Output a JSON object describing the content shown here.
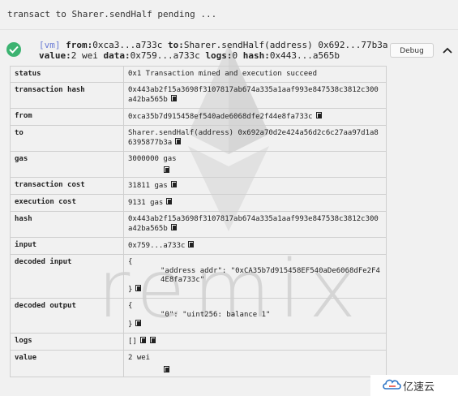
{
  "pending": "transact to Sharer.sendHalf pending ...",
  "header": {
    "vm": "[vm]",
    "from_label": "from:",
    "from_value": "0xca3...a733c",
    "to_label": "to:",
    "to_value": "Sharer.sendHalf(address) 0x692...77b3a",
    "value_label": "value:",
    "value_value": "2 wei",
    "data_label": "data:",
    "data_value": "0x759...a733c",
    "logs_label": "logs:",
    "logs_value": "0",
    "hash_label": "hash:",
    "hash_value": "0x443...a565b"
  },
  "debug_label": "Debug",
  "rows": {
    "status": {
      "key": "status",
      "value": "0x1 Transaction mined and execution succeed"
    },
    "transaction_hash": {
      "key": "transaction hash",
      "value": "0x443ab2f15a3698f3107817ab674a335a1aaf993e847538c3812c300a42ba565b"
    },
    "from": {
      "key": "from",
      "value": "0xca35b7d915458ef540ade6068dfe2f44e8fa733c"
    },
    "to": {
      "key": "to",
      "value": "Sharer.sendHalf(address) 0x692a70d2e424a56d2c6c27aa97d1a86395877b3a"
    },
    "gas": {
      "key": "gas",
      "value": "3000000 gas"
    },
    "transaction_cost": {
      "key": "transaction cost",
      "value": "31811 gas"
    },
    "execution_cost": {
      "key": "execution cost",
      "value": "9131 gas"
    },
    "hash": {
      "key": "hash",
      "value": "0x443ab2f15a3698f3107817ab674a335a1aaf993e847538c3812c300a42ba565b"
    },
    "input": {
      "key": "input",
      "value": "0x759...a733c"
    },
    "decoded_input": {
      "key": "decoded input",
      "open": "{",
      "line": "\"address addr\": \"0xCA35b7d915458EF540aDe6068dFe2F44E8fa733c\"",
      "close": "}"
    },
    "decoded_output": {
      "key": "decoded output",
      "open": "{",
      "line": "\"0\": \"uint256: balance 1\"",
      "close": "}"
    },
    "logs": {
      "key": "logs",
      "value": "[]"
    },
    "value": {
      "key": "value",
      "value": "2 wei"
    }
  },
  "watermark": "remix",
  "brand": "亿速云",
  "colors": {
    "success": "#3cb371",
    "vm": "#6a7bd5"
  }
}
